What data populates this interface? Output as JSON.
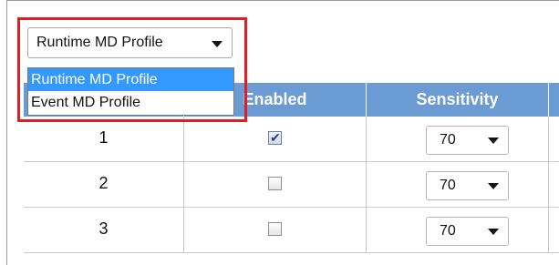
{
  "profile_select": {
    "selected": "Runtime MD Profile",
    "options": [
      "Runtime MD Profile",
      "Event MD Profile"
    ]
  },
  "table": {
    "headers": [
      "",
      "Enabled",
      "Sensitivity"
    ],
    "rows": [
      {
        "num": "1",
        "enabled": true,
        "sensitivity": "70"
      },
      {
        "num": "2",
        "enabled": false,
        "sensitivity": "70"
      },
      {
        "num": "3",
        "enabled": false,
        "sensitivity": "70"
      }
    ]
  },
  "colors": {
    "header_bg": "#6b9bd3",
    "selected_option_bg": "#3399ff",
    "highlight_border": "#e31b23"
  }
}
